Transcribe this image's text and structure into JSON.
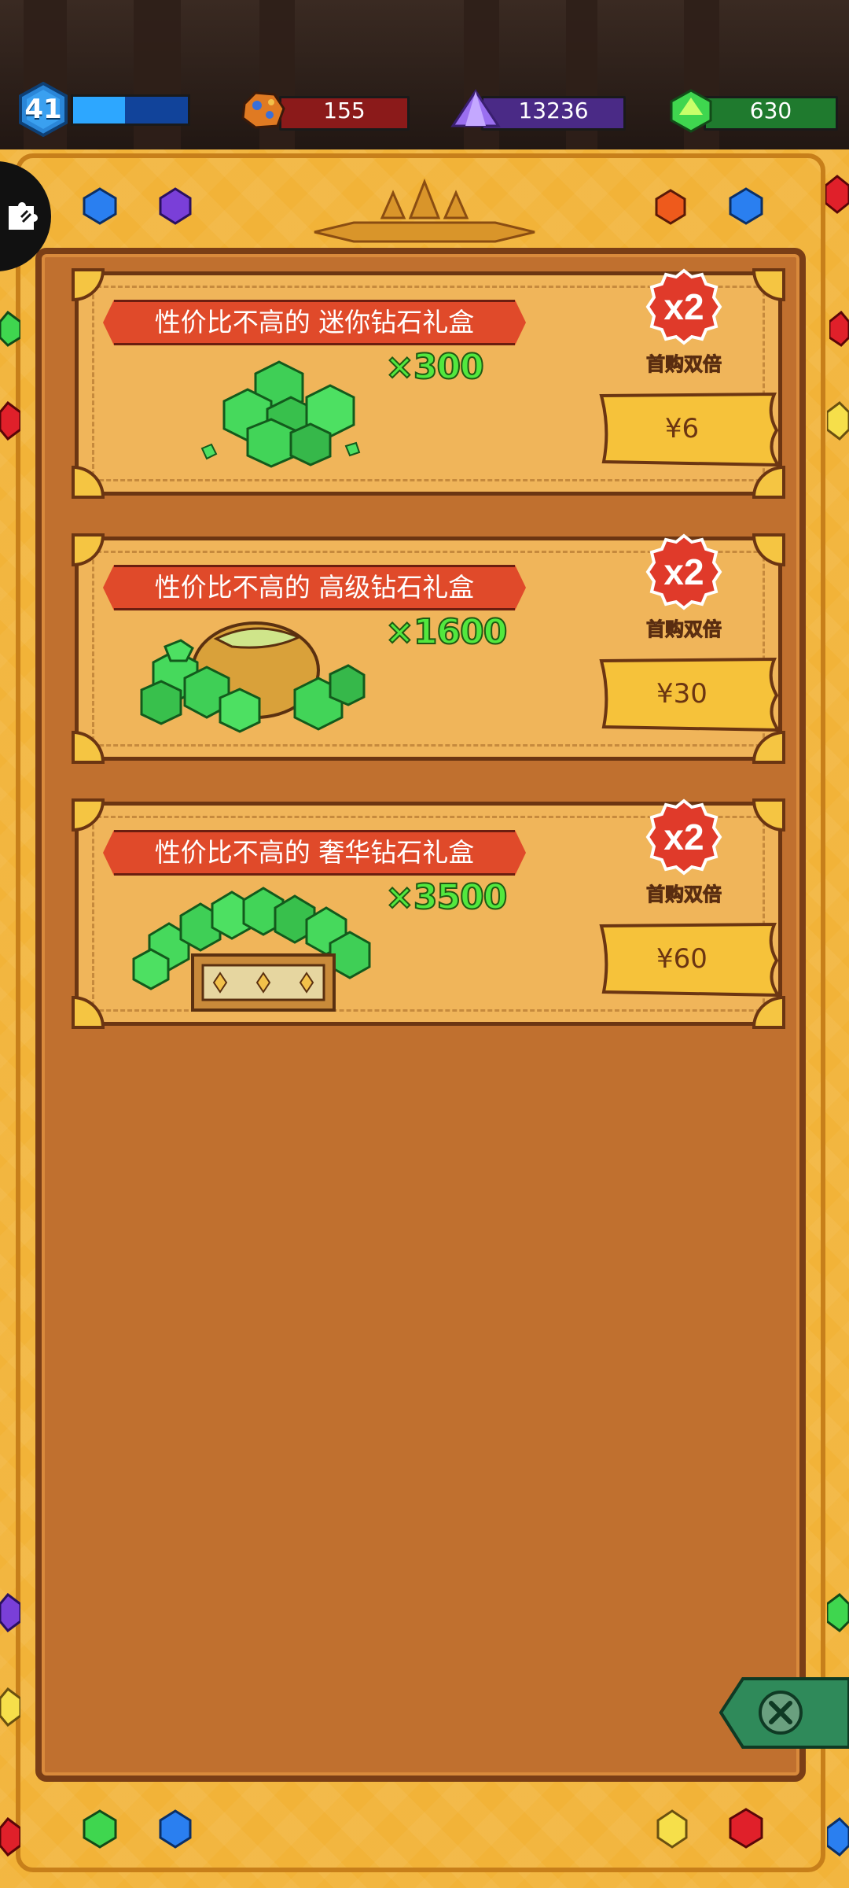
{
  "resources": {
    "level": "41",
    "xp_progress": 0.45,
    "ore": "155",
    "crystal": "13236",
    "gem": "630"
  },
  "colors": {
    "ore_bar": "#8b1a1a",
    "crystal_bar": "#4a2a86",
    "gem_bar": "#1f7a2e",
    "xp_fill": "#2da7ff",
    "frame": "#f2b338",
    "panel": "#c0702f",
    "ribbon": "#e04a2a",
    "price_button": "#f6c23a"
  },
  "icons": {
    "side_tab": "puzzle-icon",
    "close": "close-icon"
  },
  "offers": [
    {
      "title": "性价比不高的 迷你钻石礼盒",
      "quantity": "×300",
      "badge": "x2",
      "badge_label": "首购双倍",
      "price": "¥6"
    },
    {
      "title": "性价比不高的 高级钻石礼盒",
      "quantity": "×1600",
      "badge": "x2",
      "badge_label": "首购双倍",
      "price": "¥30"
    },
    {
      "title": "性价比不高的 奢华钻石礼盒",
      "quantity": "×3500",
      "badge": "x2",
      "badge_label": "首购双倍",
      "price": "¥60"
    }
  ]
}
